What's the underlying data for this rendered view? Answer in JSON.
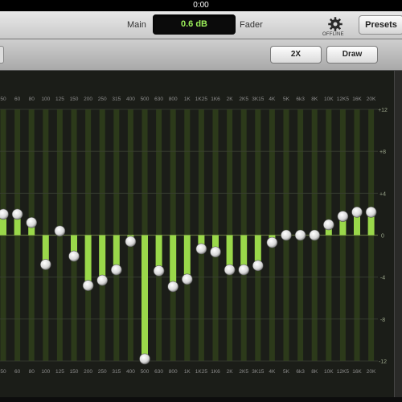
{
  "status": {
    "time": "0:00"
  },
  "header": {
    "main_label": "Main",
    "gain_value": "0.6 dB",
    "fader_label": "Fader",
    "offline_label": "OFFLINE",
    "presets_label": "Presets"
  },
  "toolbar": {
    "btn_2x": "2X",
    "btn_draw": "Draw"
  },
  "colors": {
    "accent": "#9cf05a",
    "bar": "#9ad84a",
    "band_column": "#2c3a1a"
  },
  "eq": {
    "bands": [
      "50",
      "60",
      "80",
      "100",
      "125",
      "150",
      "200",
      "250",
      "315",
      "400",
      "500",
      "630",
      "800",
      "1K",
      "1K25",
      "1K6",
      "2K",
      "2K5",
      "3K15",
      "4K",
      "5K",
      "6k3",
      "8K",
      "10K",
      "12K5",
      "16K",
      "20K"
    ],
    "gains_db": [
      2.0,
      2.0,
      1.2,
      -2.8,
      0.4,
      -2.0,
      -4.8,
      -4.3,
      -3.3,
      -0.6,
      -11.8,
      -3.4,
      -4.9,
      -4.2,
      -1.3,
      -1.6,
      -3.3,
      -3.3,
      -2.9,
      -0.7,
      0.0,
      0.0,
      0.0,
      1.0,
      1.8,
      2.2,
      2.2
    ],
    "scale_labels": [
      "+12",
      "+8",
      "+4",
      "0",
      "-4",
      "-8",
      "-12"
    ],
    "scale_values": [
      12,
      8,
      4,
      0,
      -4,
      -8,
      -12
    ],
    "range_db": [
      -12,
      12
    ]
  }
}
